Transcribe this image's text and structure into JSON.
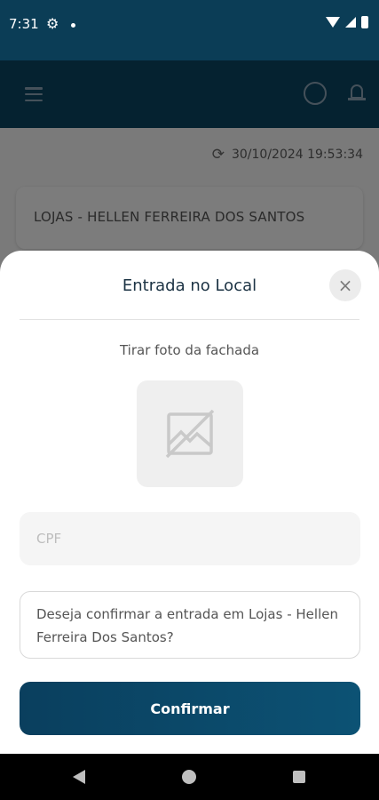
{
  "status_bar": {
    "time": "7:31"
  },
  "app_bar": {},
  "sync": {
    "datetime": "30/10/2024 19:53:34"
  },
  "store_card": {
    "title": "LOJAS -  HELLEN FERREIRA DOS SANTOS"
  },
  "sheet": {
    "title": "Entrada no Local",
    "close_label": "×",
    "photo_label": "Tirar foto da fachada",
    "cpf_placeholder": "CPF",
    "cpf_value": "",
    "confirm_message": "Deseja confirmar a entrada em Lojas - Hellen Ferreira Dos Santos?",
    "confirm_button": "Confirmar"
  },
  "colors": {
    "primary": "#0b3d56",
    "button": "#0a4866"
  }
}
